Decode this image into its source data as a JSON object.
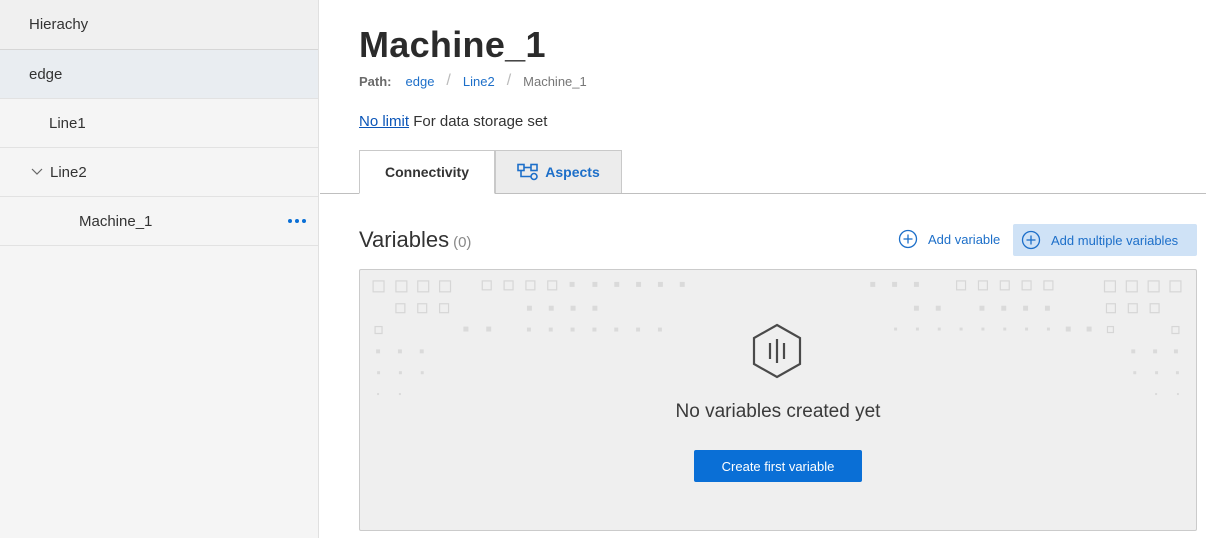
{
  "sidebar": {
    "header": "Hierachy",
    "items": [
      {
        "label": "edge",
        "selected": true
      },
      {
        "label": "Line1"
      },
      {
        "label": "Line2",
        "expanded": true
      },
      {
        "label": "Machine_1",
        "has_menu": true
      }
    ]
  },
  "main": {
    "title": "Machine_1",
    "path": {
      "label": "Path:",
      "crumbs": [
        "edge",
        "Line2"
      ],
      "current": "Machine_1"
    },
    "storage": {
      "link": "No limit",
      "text": "For data storage set"
    },
    "tabs": [
      {
        "label": "Connectivity",
        "active": true
      },
      {
        "label": "Aspects",
        "icon": "hierarchy-icon"
      }
    ],
    "variables": {
      "title": "Variables",
      "count": "(0)",
      "add_label": "Add variable",
      "add_multiple_label": "Add multiple variables",
      "empty_text": "No variables created yet",
      "create_label": "Create first variable"
    }
  },
  "colors": {
    "accent": "#0a6fd6",
    "link": "#1d6fc9",
    "highlight": "#cfe2f6"
  }
}
